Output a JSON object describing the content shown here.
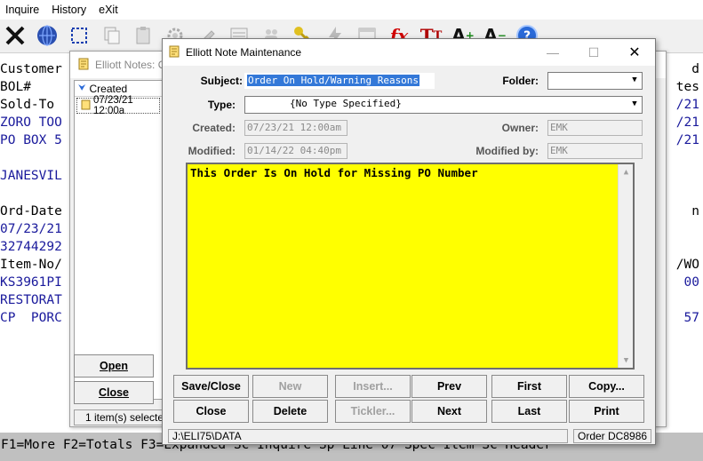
{
  "menu": {
    "items": [
      "Inquire",
      "History",
      "eXit"
    ]
  },
  "terminal": {
    "left_lines": [
      {
        "text": "Customer",
        "color": "black"
      },
      {
        "text": "BOL#",
        "color": "black"
      },
      {
        "text": "Sold-To",
        "color": "black"
      },
      {
        "text": "ZORO TOO",
        "color": "blue"
      },
      {
        "text": "PO BOX 5",
        "color": "blue"
      },
      {
        "text": "",
        "color": "black"
      },
      {
        "text": "JANESVIL",
        "color": "blue"
      },
      {
        "text": "",
        "color": "black"
      },
      {
        "text": "Ord-Date",
        "color": "black"
      },
      {
        "text": "07/23/21",
        "color": "blue"
      },
      {
        "text": "32744292",
        "color": "blue"
      },
      {
        "text": "Item-No/",
        "color": "black"
      },
      {
        "text": "KS3961PI",
        "color": "blue"
      },
      {
        "text": "RESTORAT",
        "color": "blue"
      },
      {
        "text": "CP  PORC",
        "color": "blue"
      }
    ],
    "right_fragments": [
      {
        "text": "d",
        "row": 0,
        "color": "black"
      },
      {
        "text": "tes",
        "row": 1,
        "color": "black"
      },
      {
        "text": "/21",
        "row": 2,
        "color": "blue"
      },
      {
        "text": "/21",
        "row": 3,
        "color": "blue"
      },
      {
        "text": "/21",
        "row": 4,
        "color": "blue"
      },
      {
        "text": "n",
        "row": 8,
        "color": "black"
      },
      {
        "text": "/WO",
        "row": 11,
        "color": "black"
      },
      {
        "text": "00",
        "row": 12,
        "color": "blue"
      },
      {
        "text": "57",
        "row": 14,
        "color": "blue"
      }
    ],
    "fkeys": "F1=More F2=Totals F3=Expanded Sc Inquire Sp Line 07 Spec Item Sc Header"
  },
  "notes_window": {
    "title": "Elliott Notes: O",
    "column_header": "Created",
    "rows": [
      "07/23/21 12:00a"
    ],
    "open_label": "Open",
    "close_label": "Close",
    "status": "1 item(s) selecte"
  },
  "dialog": {
    "title": "Elliott Note Maintenance",
    "subject_label": "Subject:",
    "subject_value": "Order On Hold/Warning Reasons",
    "folder_label": "Folder:",
    "folder_value": "",
    "type_label": "Type:",
    "type_value": "{No Type Specified}",
    "created_label": "Created:",
    "created_value": "07/23/21 12:00am",
    "owner_label": "Owner:",
    "owner_value": "EMK",
    "modified_label": "Modified:",
    "modified_value": "01/14/22 04:40pm",
    "modified_by_label": "Modified by:",
    "modified_by_value": "EMK",
    "memo_text": "This Order Is On Hold for Missing PO Number",
    "memo_color": "#ffff00",
    "buttons_row1": [
      {
        "label": "Save/Close",
        "enabled": true,
        "name": "save-close-button"
      },
      {
        "label": "New",
        "enabled": false,
        "name": "new-button"
      },
      {
        "label": "Insert...",
        "enabled": false,
        "name": "insert-button"
      },
      {
        "label": "Prev",
        "enabled": true,
        "name": "prev-button"
      },
      {
        "label": "First",
        "enabled": true,
        "name": "first-button"
      },
      {
        "label": "Copy...",
        "enabled": true,
        "name": "copy-button"
      }
    ],
    "buttons_row2": [
      {
        "label": "Close",
        "enabled": true,
        "name": "close-button"
      },
      {
        "label": "Delete",
        "enabled": true,
        "name": "delete-button"
      },
      {
        "label": "Tickler...",
        "enabled": false,
        "name": "tickler-button"
      },
      {
        "label": "Next",
        "enabled": true,
        "name": "next-button"
      },
      {
        "label": "Last",
        "enabled": true,
        "name": "last-button"
      },
      {
        "label": "Print",
        "enabled": true,
        "name": "print-button"
      }
    ],
    "status_path": "J:\\ELI75\\DATA",
    "status_order": "Order DC8986"
  },
  "toolbar_icons": [
    "exit-x-icon",
    "globe-icon",
    "select-icon",
    "copy-icon",
    "paste-icon",
    "settings-icon",
    "edit-icon",
    "list-icon",
    "users-icon",
    "key-icon",
    "lightning-icon",
    "window-icon",
    "fx-icon",
    "font-icon",
    "font-increase-icon",
    "font-decrease-icon",
    "help-icon"
  ],
  "colors": {
    "accent": "#3378d8",
    "terminal_blue": "#1a1a9c"
  }
}
